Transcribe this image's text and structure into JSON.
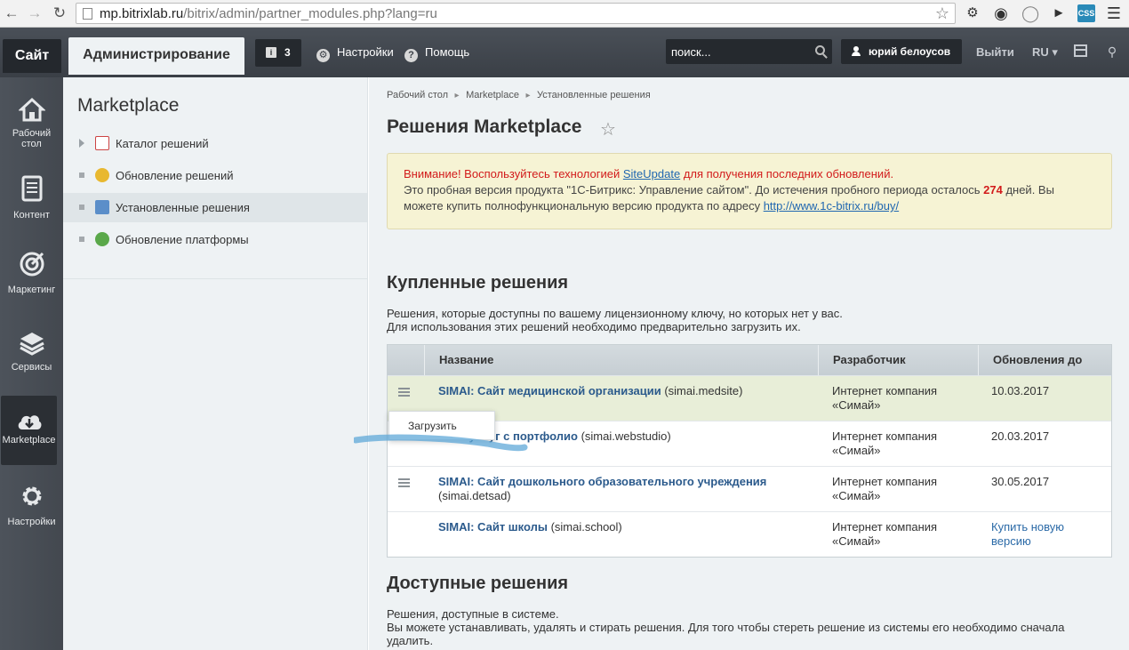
{
  "browser": {
    "url_host": "mp.bitrixlab.ru",
    "url_path": "/bitrix/admin/partner_modules.php?lang=ru"
  },
  "top_panel": {
    "site_tab": "Сайт",
    "admin_tab": "Администрирование",
    "notifications_count": "3",
    "settings_label": "Настройки",
    "help_label": "Помощь",
    "search_placeholder": "поиск...",
    "user_name": "юрий белоусов",
    "exit_label": "Выйти",
    "lang_label": "RU"
  },
  "sidebar": {
    "items": [
      {
        "label_line1": "Рабочий",
        "label_line2": "стол",
        "icon": "home-icon"
      },
      {
        "label_line1": "Контент",
        "label_line2": "",
        "icon": "document-icon"
      },
      {
        "label_line1": "Маркетинг",
        "label_line2": "",
        "icon": "target-icon"
      },
      {
        "label_line1": "Сервисы",
        "label_line2": "",
        "icon": "layers-icon"
      },
      {
        "label_line1": "Marketplace",
        "label_line2": "",
        "icon": "cloud-download-icon"
      },
      {
        "label_line1": "Настройки",
        "label_line2": "",
        "icon": "gear-icon"
      }
    ]
  },
  "menu": {
    "title": "Marketplace",
    "items": [
      {
        "label": "Каталог решений"
      },
      {
        "label": "Обновление решений"
      },
      {
        "label": "Установленные решения"
      },
      {
        "label": "Обновление платформы"
      }
    ]
  },
  "content": {
    "breadcrumb": [
      "Рабочий стол",
      "Marketplace",
      "Установленные решения"
    ],
    "title": "Решения Marketplace",
    "alert": {
      "line1_prefix": "Внимание! Воспользуйтесь технологией ",
      "line1_link": "SiteUpdate",
      "line1_suffix": " для получения последних обновлений.",
      "line2_prefix": "Это пробная версия продукта \"1С-Битрикс: Управление сайтом\". До истечения пробного периода осталось ",
      "days": "274",
      "line2_suffix": " дней. Вы",
      "line3_prefix": "можете купить полнофункциональную версию продукта по адресу ",
      "line3_link": "http://www.1c-bitrix.ru/buy/"
    },
    "purchased": {
      "heading": "Купленные решения",
      "desc1": "Решения, которые доступны по вашему лицензионному ключу, но которых нет у вас.",
      "desc2": "Для использования этих решений необходимо предварительно загрузить их.",
      "columns": [
        "Название",
        "Разработчик",
        "Обновления до"
      ],
      "rows": [
        {
          "name": "SIMAI: Сайт медицинской организации",
          "code": " (simai.medsite)",
          "dev1": "Интернет компания",
          "dev2": "«Симай»",
          "date": "10.03.2017",
          "date2": ""
        },
        {
          "name": "ании услуг с портфолио",
          "code": " (simai.webstudio)",
          "dev1": "Интернет компания",
          "dev2": "«Симай»",
          "date": "20.03.2017",
          "date2": ""
        },
        {
          "name": "SIMAI: Сайт дошкольного образовательного учреждения",
          "code": "(simai.detsad)",
          "dev1": "Интернет компания",
          "dev2": "«Симай»",
          "date": "30.05.2017",
          "date2": ""
        },
        {
          "name": "SIMAI: Сайт школы",
          "code": " (simai.school)",
          "dev1": "Интернет компания",
          "dev2": "«Симай»",
          "date": "Купить новую",
          "date2": "версию"
        }
      ],
      "popup_item": "Загрузить"
    },
    "available": {
      "heading": "Доступные решения",
      "desc1": "Решения, доступные в системе.",
      "desc2": "Вы можете устанавливать, удалять и стирать решения. Для того чтобы стереть решение из системы его необходимо сначала",
      "desc3": "удалить."
    }
  }
}
